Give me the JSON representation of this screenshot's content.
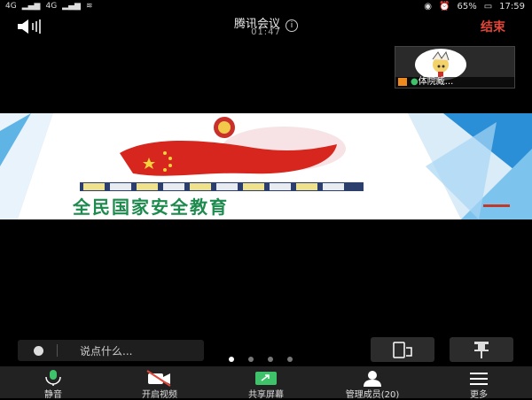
{
  "statusbar": {
    "left_items": [
      "4G",
      "4G"
    ],
    "battery": "65%",
    "time": "17:59"
  },
  "header": {
    "title": "腾讯会议",
    "info_glyph": "i",
    "timer": "01:47",
    "end_label": "结束"
  },
  "participant_thumb": {
    "name": "体院臧..."
  },
  "slide": {
    "slogan": "全民国家安全教育",
    "colors": {
      "flag_red": "#d7261e",
      "slogan_green": "#1e8b4e",
      "accent_blue": "#2a8fd6"
    }
  },
  "chat": {
    "placeholder": "说点什么..."
  },
  "toolbar": {
    "items": [
      {
        "label": "静音",
        "icon": "microphone-icon"
      },
      {
        "label": "开启视频",
        "icon": "video-off-icon"
      },
      {
        "label": "共享屏幕",
        "icon": "share-screen-icon"
      },
      {
        "label": "管理成员(20)",
        "icon": "members-icon"
      },
      {
        "label": "更多",
        "icon": "more-icon"
      }
    ]
  }
}
